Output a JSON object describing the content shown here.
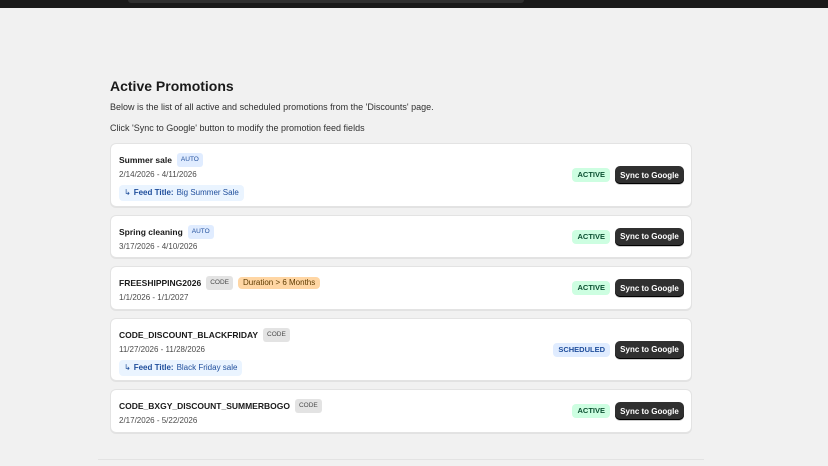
{
  "page": {
    "title": "Active Promotions",
    "description_1": "Below is the list of all active and scheduled promotions from the 'Discounts' page.",
    "description_2": "Click 'Sync to Google' button to modify the promotion feed fields"
  },
  "promotions": [
    {
      "name": "Summer sale",
      "tag": "AUTO",
      "dates": "2/14/2026 - 4/11/2026",
      "feed_arrow": "↳",
      "feed_label": "Feed Title:",
      "feed_value": "Big Summer Sale",
      "status": "ACTIVE",
      "button": "Sync to Google"
    },
    {
      "name": "Spring cleaning",
      "tag": "AUTO",
      "dates": "3/17/2026 - 4/10/2026",
      "status": "ACTIVE",
      "button": "Sync to Google"
    },
    {
      "name": "FREESHIPPING2026",
      "tag": "CODE",
      "extra_tag": "Duration > 6 Months",
      "dates": "1/1/2026 - 1/1/2027",
      "status": "ACTIVE",
      "button": "Sync to Google"
    },
    {
      "name": "CODE_DISCOUNT_BLACKFRIDAY",
      "tag": "CODE",
      "dates": "11/27/2026 - 11/28/2026",
      "feed_arrow": "↳",
      "feed_label": "Feed Title:",
      "feed_value": "Black Friday sale",
      "status": "SCHEDULED",
      "button": "Sync to Google"
    },
    {
      "name": "CODE_BXGY_DISCOUNT_SUMMERBOGO",
      "tag": "CODE",
      "dates": "2/17/2026 - 5/22/2026",
      "status": "ACTIVE",
      "button": "Sync to Google"
    }
  ],
  "colors": {
    "background": "#f1f1f1",
    "topbar": "#1a1a1a",
    "button": "#303030",
    "active_badge": "#cdfee1",
    "scheduled_badge": "#e0ecff",
    "duration_badge": "#ffd6a4"
  }
}
